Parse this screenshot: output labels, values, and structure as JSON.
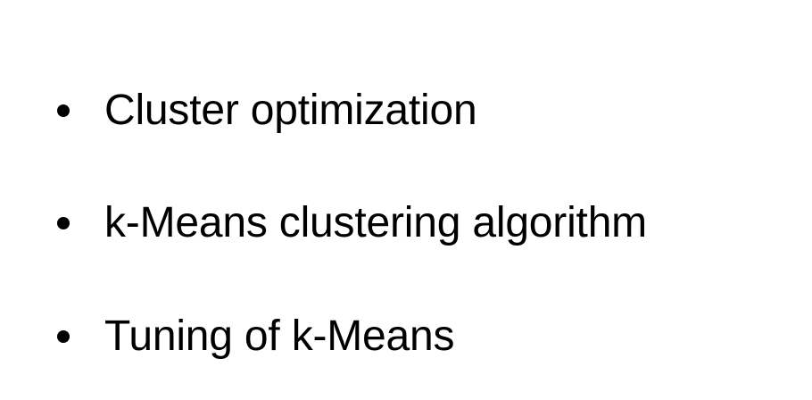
{
  "slide": {
    "bullets": [
      {
        "text": "Cluster optimization"
      },
      {
        "text": "k-Means clustering algorithm"
      },
      {
        "text": "Tuning of k-Means"
      }
    ]
  },
  "colors": {
    "background": "#ffffff",
    "text": "#000000"
  }
}
